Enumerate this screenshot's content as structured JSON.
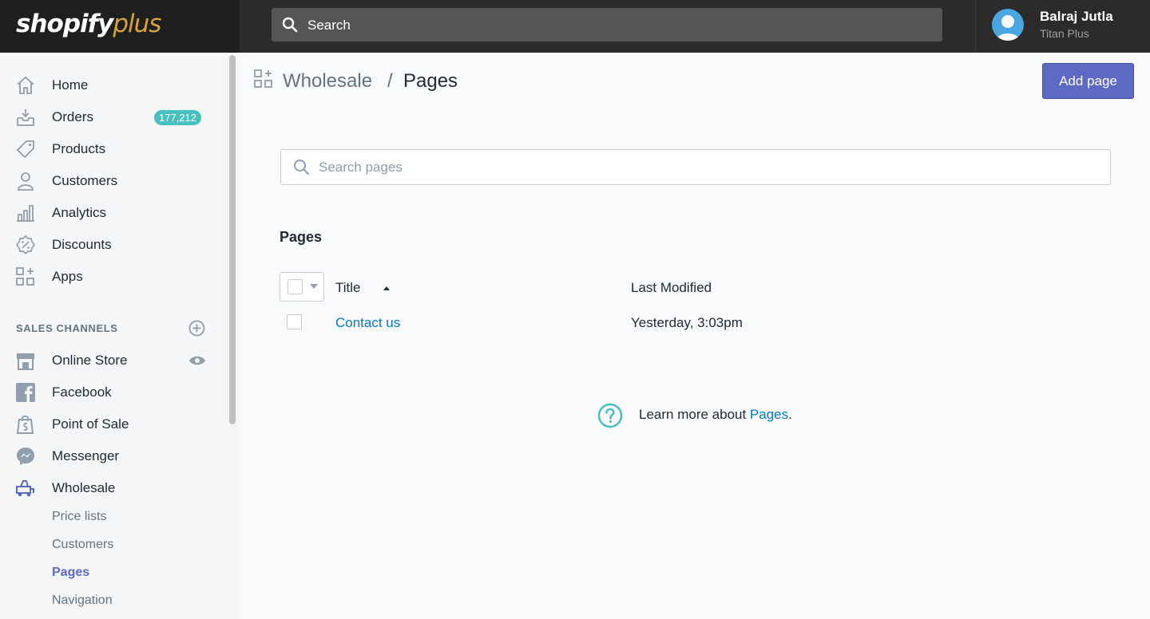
{
  "topbar": {
    "logo_word": "shopify",
    "logo_plus": "plus",
    "search_placeholder": "Search",
    "user_name": "Balraj Jutla",
    "user_store": "Titan Plus"
  },
  "sidebar": {
    "items": [
      {
        "label": "Home",
        "icon": "home-icon"
      },
      {
        "label": "Orders",
        "icon": "orders-icon",
        "badge": "177,212"
      },
      {
        "label": "Products",
        "icon": "tag-icon"
      },
      {
        "label": "Customers",
        "icon": "customer-icon"
      },
      {
        "label": "Analytics",
        "icon": "analytics-icon"
      },
      {
        "label": "Discounts",
        "icon": "discount-icon"
      },
      {
        "label": "Apps",
        "icon": "apps-icon"
      }
    ],
    "sales_channels_title": "SALES CHANNELS",
    "channels": [
      {
        "label": "Online Store",
        "icon": "store-icon"
      },
      {
        "label": "Facebook",
        "icon": "facebook-icon"
      },
      {
        "label": "Point of Sale",
        "icon": "pos-icon"
      },
      {
        "label": "Messenger",
        "icon": "messenger-icon"
      },
      {
        "label": "Wholesale",
        "icon": "wholesale-icon"
      }
    ],
    "sub_items": [
      {
        "label": "Price lists",
        "active": false
      },
      {
        "label": "Customers",
        "active": false
      },
      {
        "label": "Pages",
        "active": true
      },
      {
        "label": "Navigation",
        "active": false
      }
    ]
  },
  "main": {
    "breadcrumb_parent": "Wholesale",
    "breadcrumb_sep": "/",
    "breadcrumb_current": "Pages",
    "add_button": "Add page",
    "search_placeholder": "Search pages",
    "section_title": "Pages",
    "columns": {
      "title": "Title",
      "last_modified": "Last Modified"
    },
    "rows": [
      {
        "title": "Contact us",
        "last_modified": "Yesterday, 3:03pm"
      }
    ],
    "help_prefix": "Learn more about ",
    "help_link": "Pages",
    "help_suffix": "."
  },
  "colors": {
    "accent": "#5c6ac4",
    "link": "#007ace",
    "badge": "#47c1bf",
    "topbar": "#2b2b2b"
  }
}
